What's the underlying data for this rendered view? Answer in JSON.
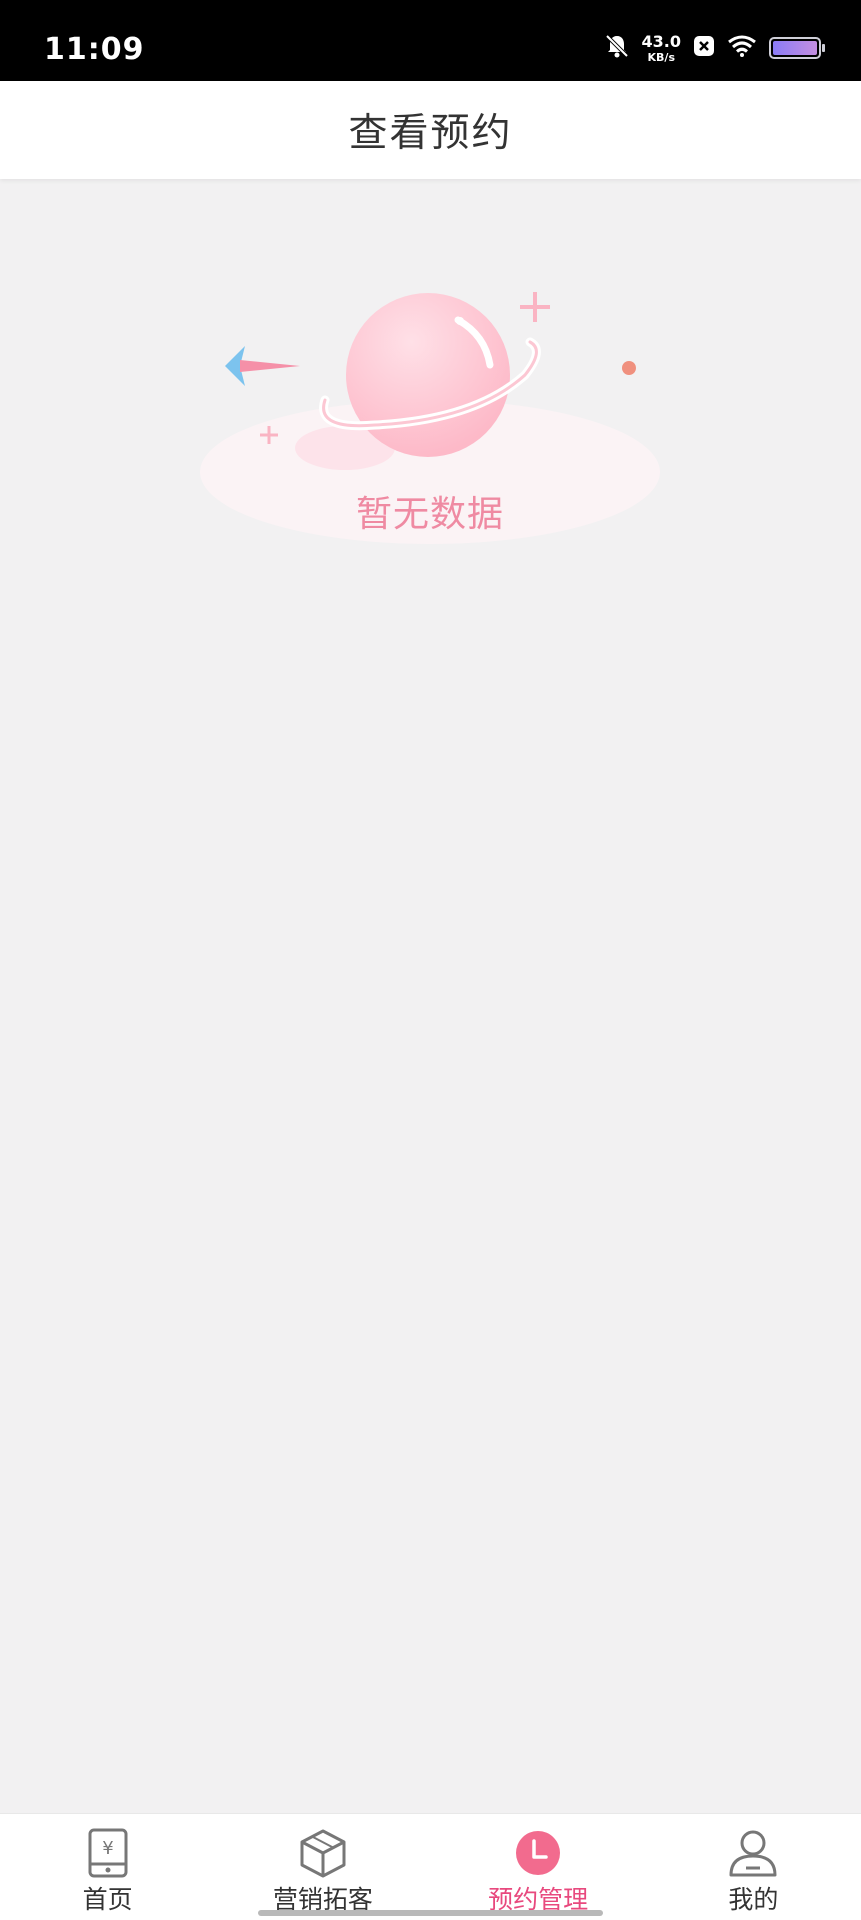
{
  "status_bar": {
    "time": "11:09",
    "net_speed_value": "43.0",
    "net_speed_unit": "KB/s",
    "icons": [
      "bell-off-icon",
      "close-box-icon",
      "wifi-icon",
      "battery-icon"
    ]
  },
  "header": {
    "title": "查看预约"
  },
  "empty_state": {
    "text": "暂无数据",
    "illustration": "planet-icon"
  },
  "bottom_nav": {
    "items": [
      {
        "label": "首页",
        "icon": "phone-yuan-icon",
        "active": false
      },
      {
        "label": "营销拓客",
        "icon": "cube-icon",
        "active": false
      },
      {
        "label": "预约管理",
        "icon": "clock-icon",
        "active": true
      },
      {
        "label": "我的",
        "icon": "user-icon",
        "active": false
      }
    ]
  },
  "colors": {
    "accent": "#e8497e",
    "background": "#f2f1f2",
    "empty_text": "#ef8aa2"
  }
}
